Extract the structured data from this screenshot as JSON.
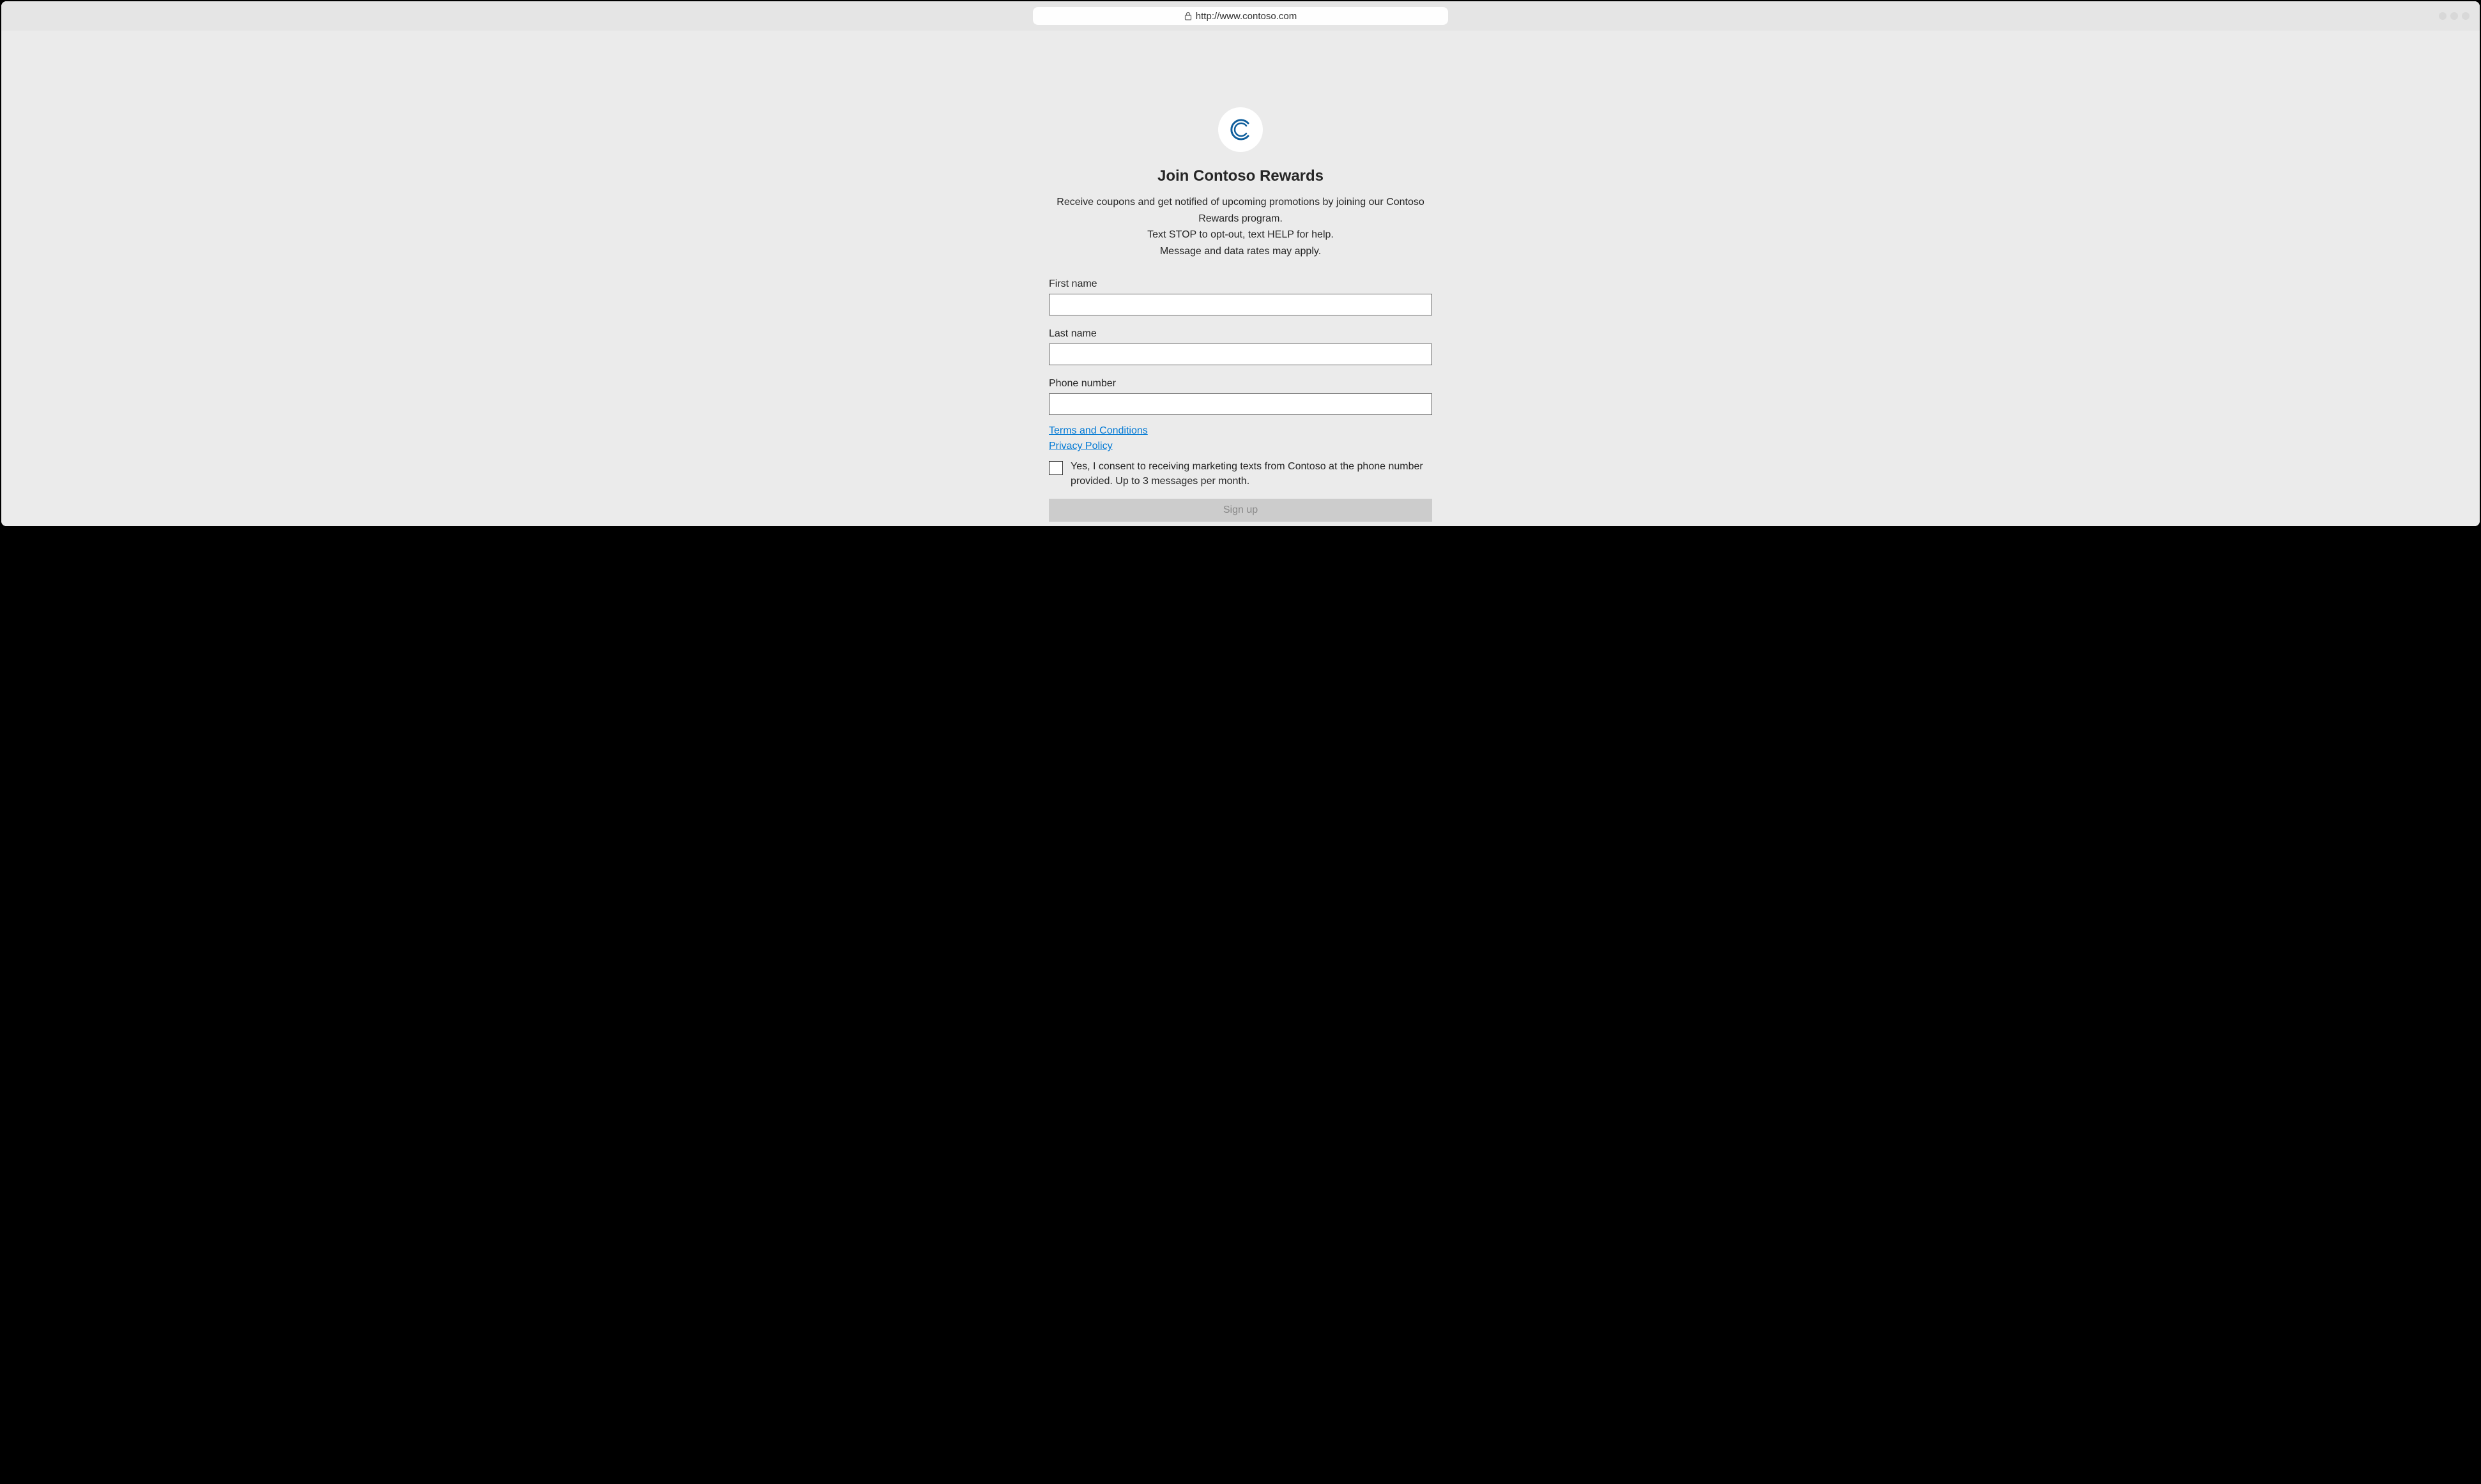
{
  "browser": {
    "url": "http://www.contoso.com"
  },
  "page": {
    "title": "Join Contoso Rewards",
    "description_line1": "Receive coupons and get notified of upcoming promotions by joining our Contoso Rewards program.",
    "description_line2": "Text STOP to opt-out, text HELP for help.",
    "description_line3": "Message and data rates may apply."
  },
  "form": {
    "first_name_label": "First name",
    "first_name_value": "",
    "last_name_label": "Last name",
    "last_name_value": "",
    "phone_label": "Phone number",
    "phone_value": "",
    "terms_link": "Terms and Conditions",
    "privacy_link": "Privacy Policy",
    "consent_text": "Yes, I consent to receiving marketing texts from Contoso at the phone number provided. Up to 3 messages per month.",
    "signup_button": "Sign up"
  }
}
